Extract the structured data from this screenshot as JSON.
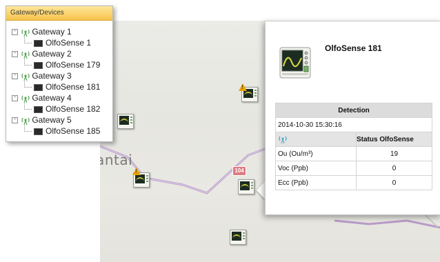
{
  "tree": {
    "header": "Gateway/Devices",
    "gateways": [
      {
        "label": "Gateway 1",
        "device": "OlfoSense 1"
      },
      {
        "label": "Gateway 2",
        "device": "OlfoSense 179"
      },
      {
        "label": "Gateway 3",
        "device": "OlfoSense 181"
      },
      {
        "label": "Gateway 4",
        "device": "OlfoSense 182"
      },
      {
        "label": "Gateway 5",
        "device": "OlfoSense 185"
      }
    ]
  },
  "map": {
    "city_label": "iantai",
    "road_badge": "104",
    "road_color": "#b89bc8"
  },
  "popup": {
    "title": "OlfoSense 181",
    "detection_header": "Detection",
    "timestamp": "2014-10-30 15:30:16",
    "status_header": "Status OlfoSense",
    "rows": [
      {
        "label": "Ou (Ou/m³)",
        "value": "19"
      },
      {
        "label": "Voc (Ppb)",
        "value": "0"
      },
      {
        "label": "Ecc (Ppb)",
        "value": "0"
      }
    ]
  },
  "colors": {
    "tree_header": "#f7c34b",
    "warning": "#e9a300",
    "gateway_icon": "#5aa35a"
  }
}
